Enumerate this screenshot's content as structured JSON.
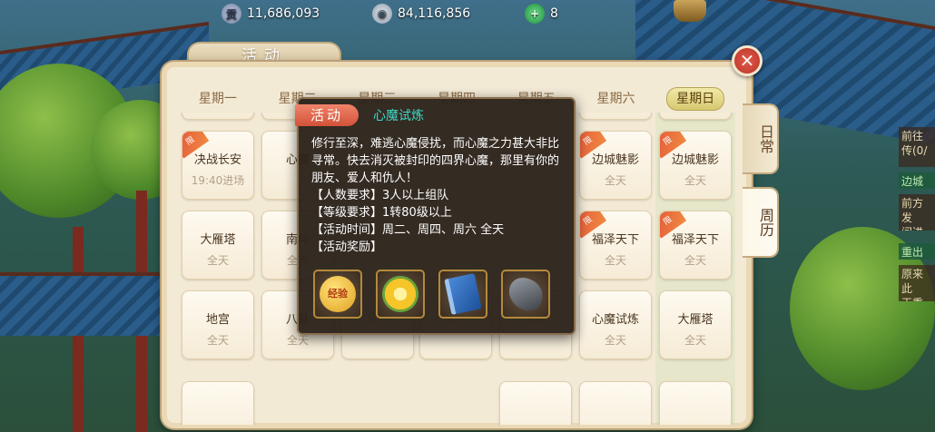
{
  "currency": {
    "gong_icon_text": "贡",
    "gong": "11,686,093",
    "silver": "84,116,856",
    "jade": "8"
  },
  "panel": {
    "title": "活动",
    "close_label": "×",
    "side_tabs": [
      "日常",
      "周历"
    ]
  },
  "weekdays": [
    "星期一",
    "星期二",
    "星期三",
    "星期四",
    "星期五",
    "星期六",
    "星期日"
  ],
  "grid": {
    "row1": [
      {
        "name": "决战长安",
        "time": "19:40进场",
        "badge": "限"
      },
      {
        "name": "心魔",
        "time": ""
      },
      {
        "name": "边城魅影",
        "time": "全天",
        "badge": "限"
      },
      {
        "name": "边城魅影",
        "time": "全天",
        "badge": "限"
      }
    ],
    "row2": [
      {
        "name": "大雁塔",
        "time": "全天"
      },
      {
        "name": "南斗",
        "time": "全天"
      },
      {
        "name": "福泽天下",
        "time": "全天",
        "badge": "限"
      },
      {
        "name": "福泽天下",
        "time": "全天",
        "badge": "限"
      }
    ],
    "row3": [
      {
        "name": "地宫",
        "time": "全天"
      },
      {
        "name": "八卦",
        "time": "全天"
      },
      {
        "name": "",
        "time": "全天"
      },
      {
        "name": "",
        "time": "全天"
      },
      {
        "name": "",
        "time": "全天"
      },
      {
        "name": "心魔试炼",
        "time": "全天"
      },
      {
        "name": "大雁塔",
        "time": "全天"
      }
    ]
  },
  "tooltip": {
    "tag": "活动",
    "activity_name": "心魔试炼",
    "description": "修行至深，难逃心魔侵扰，而心魔之力甚大非比寻常。快去消灭被封印的四界心魔，那里有你的朋友、爱人和仇人！",
    "people": "【人数要求】3人以上组队",
    "level": "【等级要求】1转80级以上",
    "time": "【活动时间】周二、周四、周六 全天",
    "reward_label": "【活动奖励】",
    "rewards": [
      {
        "icon": "exp-icon",
        "text": "经验"
      },
      {
        "icon": "sunflower-icon"
      },
      {
        "icon": "skill-book-icon"
      },
      {
        "icon": "stone-icon"
      }
    ]
  },
  "right_side": {
    "lines": [
      "前往",
      "传(0/",
      "边城",
      "前方发",
      "间进",
      "重出",
      "原来此",
      "王重"
    ]
  },
  "colors": {
    "tooltip_bg": "#2c221a",
    "tag_red": "#e25c4a",
    "activity_name": "#3fd8c8",
    "panel_bg": "#f3ead6"
  }
}
